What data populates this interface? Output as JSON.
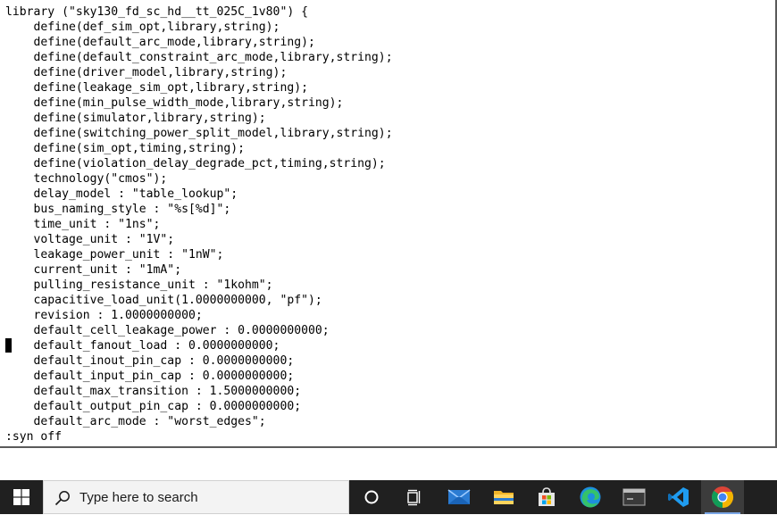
{
  "editor": {
    "lines": [
      "library (\"sky130_fd_sc_hd__tt_025C_1v80\") {",
      "    define(def_sim_opt,library,string);",
      "    define(default_arc_mode,library,string);",
      "    define(default_constraint_arc_mode,library,string);",
      "    define(driver_model,library,string);",
      "    define(leakage_sim_opt,library,string);",
      "    define(min_pulse_width_mode,library,string);",
      "    define(simulator,library,string);",
      "    define(switching_power_split_model,library,string);",
      "    define(sim_opt,timing,string);",
      "    define(violation_delay_degrade_pct,timing,string);",
      "    technology(\"cmos\");",
      "    delay_model : \"table_lookup\";",
      "    bus_naming_style : \"%s[%d]\";",
      "    time_unit : \"1ns\";",
      "    voltage_unit : \"1V\";",
      "    leakage_power_unit : \"1nW\";",
      "    current_unit : \"1mA\";",
      "    pulling_resistance_unit : \"1kohm\";",
      "    capacitive_load_unit(1.0000000000, \"pf\");",
      "    revision : 1.0000000000;",
      "    default_cell_leakage_power : 0.0000000000;",
      "    default_fanout_load : 0.0000000000;",
      "    default_inout_pin_cap : 0.0000000000;",
      "    default_input_pin_cap : 0.0000000000;",
      "    default_max_transition : 1.5000000000;",
      "    default_output_pin_cap : 0.0000000000;",
      "    default_arc_mode : \"worst_edges\";"
    ],
    "command_line": ":syn off"
  },
  "taskbar": {
    "search_placeholder": "Type here to search",
    "icons": [
      "windows-start-icon",
      "search-icon",
      "cortana-icon",
      "task-view-icon",
      "mail-icon",
      "file-explorer-icon",
      "store-icon",
      "edge-icon",
      "terminal-icon",
      "vscode-icon",
      "chrome-icon"
    ],
    "colors": {
      "background": "#202020",
      "search_box": "#f3f3f3",
      "active_indicator": "#7aa7e6"
    }
  }
}
